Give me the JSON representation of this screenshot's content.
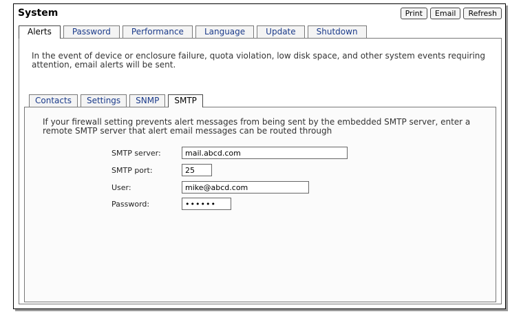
{
  "header": {
    "title": "System",
    "buttons": {
      "print": "Print",
      "email": "Email",
      "refresh": "Refresh"
    }
  },
  "outer_tabs": [
    {
      "label": "Alerts",
      "active": true
    },
    {
      "label": "Password",
      "active": false
    },
    {
      "label": "Performance",
      "active": false
    },
    {
      "label": "Language",
      "active": false
    },
    {
      "label": "Update",
      "active": false
    },
    {
      "label": "Shutdown",
      "active": false
    }
  ],
  "alerts": {
    "intro": "In the event of device or enclosure failure, quota violation, low disk space, and other system events requiring attention, email alerts will be sent."
  },
  "inner_tabs": [
    {
      "label": "Contacts",
      "active": false
    },
    {
      "label": "Settings",
      "active": false
    },
    {
      "label": "SNMP",
      "active": false
    },
    {
      "label": "SMTP",
      "active": true
    }
  ],
  "smtp": {
    "description": "If your firewall setting prevents alert messages from being sent by the embedded SMTP server, enter a remote SMTP server that alert email messages can be routed through",
    "server_label": "SMTP server:",
    "server_value": "mail.abcd.com",
    "port_label": "SMTP port:",
    "port_value": "25",
    "user_label": "User:",
    "user_value": "mike@abcd.com",
    "password_label": "Password:",
    "password_value": "••••••"
  },
  "colors": {
    "tab_link": "#1a3a8a",
    "frame_shadow": "#9a9a9a"
  }
}
